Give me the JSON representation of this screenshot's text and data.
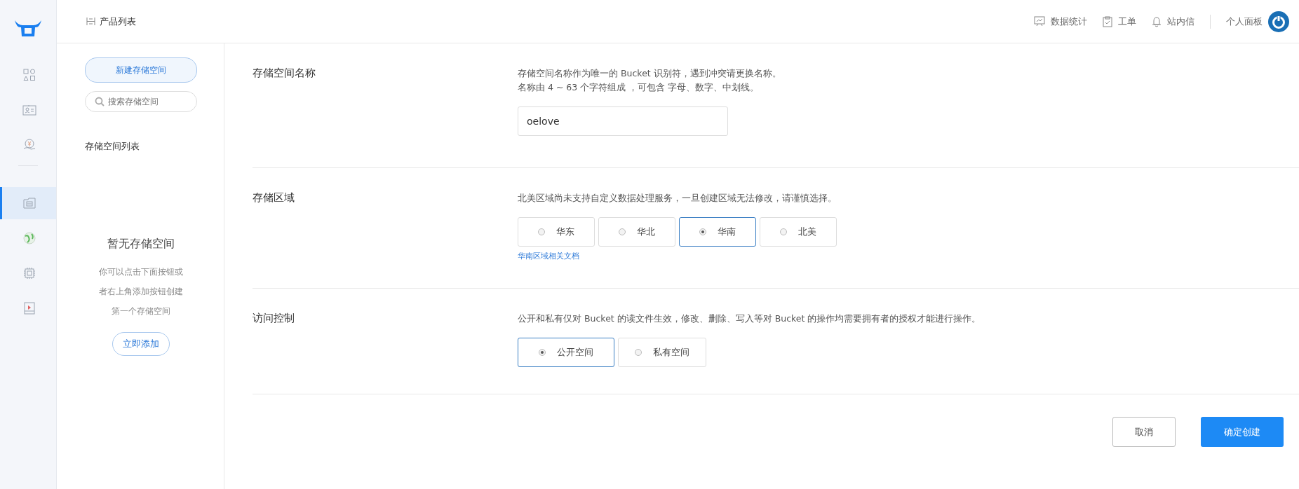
{
  "header": {
    "breadcrumb": "产品列表",
    "nav": [
      {
        "kind": "stats",
        "label": "数据统计"
      },
      {
        "kind": "ticket",
        "label": "工单"
      },
      {
        "kind": "bell",
        "label": "站内信"
      }
    ],
    "user": "个人面板"
  },
  "rail": {
    "top": [
      {
        "kind": "apps",
        "selected": false
      },
      {
        "kind": "card",
        "selected": false
      },
      {
        "kind": "money",
        "selected": false
      }
    ],
    "bottom": [
      {
        "kind": "storage",
        "selected": true
      },
      {
        "kind": "globe",
        "selected": false
      },
      {
        "kind": "chip",
        "selected": false
      },
      {
        "kind": "video",
        "selected": false
      }
    ]
  },
  "panel": {
    "new_button": "新建存储空间",
    "search_placeholder": "搜索存储空间",
    "list_title": "存储空间列表",
    "empty_title": "暂无存储空间",
    "empty_lines": [
      "你可以点击下面按钮或",
      "者右上角添加按钮创建",
      "第一个存储空间"
    ],
    "add_button": "立即添加"
  },
  "form": {
    "name": {
      "label": "存储空间名称",
      "description": [
        "存储空间名称作为唯一的 Bucket 识别符，遇到冲突请更换名称。",
        "名称由 4 ~ 63 个字符组成 ，可包含 字母、数字、中划线。"
      ],
      "value": "oelove"
    },
    "region": {
      "label": "存储区域",
      "description": "北美区域尚未支持自定义数据处理服务，一旦创建区域无法修改，请谨慎选择。",
      "options": [
        {
          "label": "华东",
          "selected": false
        },
        {
          "label": "华北",
          "selected": false
        },
        {
          "label": "华南",
          "selected": true
        },
        {
          "label": "北美",
          "selected": false
        }
      ],
      "link": "华南区域相关文档"
    },
    "access": {
      "label": "访问控制",
      "description": "公开和私有仅对 Bucket 的读文件生效，修改、删除、写入等对 Bucket 的操作均需要拥有者的授权才能进行操作。",
      "options": [
        {
          "label": "公开空间",
          "selected": true
        },
        {
          "label": "私有空间",
          "selected": false
        }
      ]
    }
  },
  "actions": {
    "cancel": "取消",
    "confirm": "确定创建"
  }
}
